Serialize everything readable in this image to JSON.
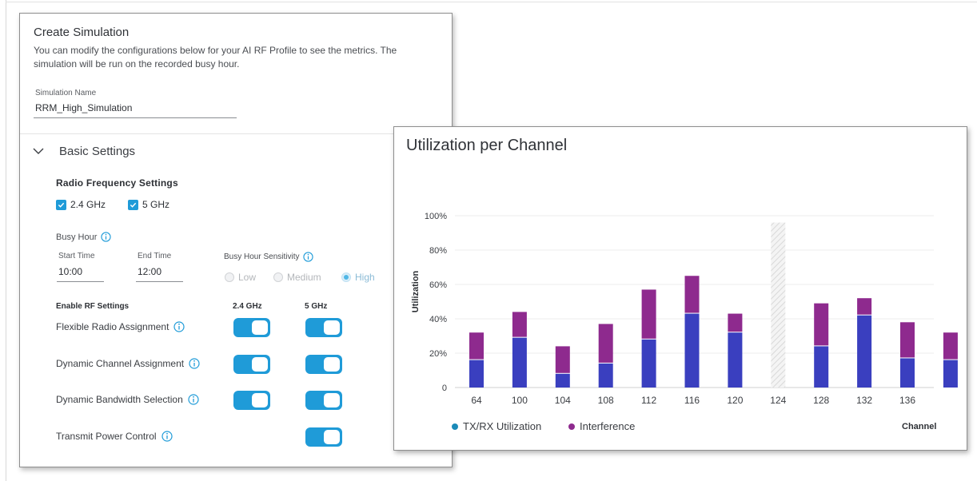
{
  "simulation": {
    "title": "Create Simulation",
    "description": "You can modify the configurations below for your AI RF Profile to see the metrics. The simulation will be run on the recorded busy hour.",
    "name_label": "Simulation Name",
    "name_value": "RRM_High_Simulation",
    "section_title": "Basic Settings",
    "rf_heading": "Radio Frequency Settings",
    "bands": [
      {
        "label": "2.4 GHz",
        "checked": true
      },
      {
        "label": "5 GHz",
        "checked": true
      }
    ],
    "busy_hour": {
      "label": "Busy Hour",
      "start_label": "Start Time",
      "start_value": "10:00",
      "end_label": "End Time",
      "end_value": "12:00",
      "sensitivity_label": "Busy Hour Sensitivity",
      "options": [
        "Low",
        "Medium",
        "High"
      ],
      "selected": "High"
    },
    "rf_settings": {
      "heading": "Enable RF Settings",
      "col_24": "2.4 GHz",
      "col_5": "5 GHz",
      "rows": [
        {
          "label": "Flexible Radio Assignment",
          "ghz24": true,
          "ghz5": true
        },
        {
          "label": "Dynamic Channel Assignment",
          "ghz24": true,
          "ghz5": true
        },
        {
          "label": "Dynamic Bandwidth Selection",
          "ghz24": true,
          "ghz5": true
        },
        {
          "label": "Transmit Power Control",
          "ghz24": null,
          "ghz5": true
        }
      ]
    }
  },
  "colors": {
    "accent": "#1f9bd8",
    "txrx": "#3a3fbf",
    "interference": "#8e2a8e",
    "legend_txrx": "#1b8ab8"
  },
  "chart_data": {
    "type": "bar",
    "title": "Utilization per Channel",
    "xlabel": "Channel",
    "ylabel": "Utilization",
    "ylim": [
      0,
      100
    ],
    "yticks": [
      "0",
      "20%",
      "40%",
      "60%",
      "80%",
      "100%"
    ],
    "categories": [
      "64",
      "100",
      "104",
      "108",
      "112",
      "116",
      "120",
      "124",
      "128",
      "132",
      "136",
      ""
    ],
    "series": [
      {
        "name": "TX/RX Utilization",
        "values": [
          16,
          29,
          8,
          14,
          28,
          43,
          32,
          null,
          24,
          42,
          17,
          16
        ]
      },
      {
        "name": "Interference",
        "values": [
          16,
          15,
          16,
          23,
          29,
          22,
          11,
          null,
          25,
          10,
          21,
          16
        ]
      }
    ],
    "unavailable": [
      "124"
    ],
    "legend_position": "bottom-left",
    "grid": true
  }
}
